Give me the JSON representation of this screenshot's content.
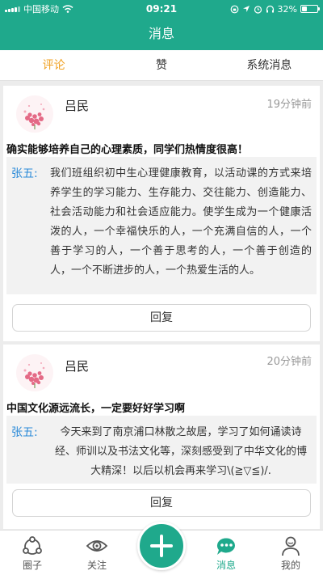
{
  "status_bar": {
    "carrier": "中国移动",
    "time": "09:21",
    "battery": "32%",
    "battery_level": 0.32
  },
  "header": {
    "title": "消息"
  },
  "tabs": [
    {
      "label": "评论",
      "active": true
    },
    {
      "label": "赞",
      "active": false
    },
    {
      "label": "系统消息",
      "active": false
    }
  ],
  "messages": [
    {
      "author": "吕民",
      "time": "19分钟前",
      "content": "确实能够培养自己的心理素质，同学们热情度很高！",
      "quote_author": "张五:",
      "quote_text": "我们班组织初中生心理健康教育，以活动课的方式来培养学生的学习能力、生存能力、交往能力、创造能力、社会活动能力和社会适应能力。使学生成为一个健康活泼的人，一个幸福快乐的人，一个充满自信的人，一个善于学习的人，一个善于思考的人，一个善于创造的人，一个不断进步的人，一个热爱生活的人。",
      "reply_label": "回复"
    },
    {
      "author": "吕民",
      "time": "20分钟前",
      "content": "中国文化源远流长，一定要好好学习啊",
      "quote_author": "张五:",
      "quote_text": "今天来到了南京浦口林散之故居，学习了如何诵读诗经、师训以及书法文化等，深刻感受到了中华文化的博大精深！以后以机会再来学习\\(≧▽≦)/.",
      "reply_label": "回复"
    }
  ],
  "bottom_nav": [
    {
      "label": "圈子",
      "icon": "circle-icon"
    },
    {
      "label": "关注",
      "icon": "eye-icon"
    },
    {
      "label": "",
      "icon": "plus-icon"
    },
    {
      "label": "消息",
      "icon": "chat-icon",
      "active": true
    },
    {
      "label": "我的",
      "icon": "user-icon"
    }
  ],
  "colors": {
    "brand": "#1fa98c",
    "active_tab": "#f0a020",
    "quote_author": "#2a8ad8"
  }
}
